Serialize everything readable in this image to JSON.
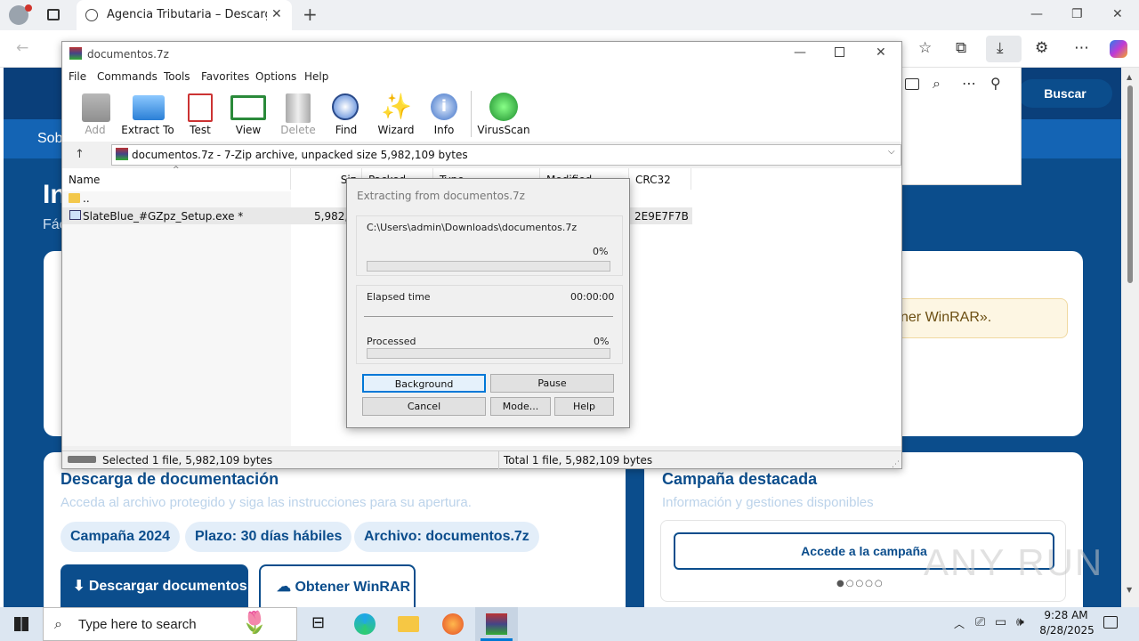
{
  "browser": {
    "tab_title": "Agencia Tributaria – Descarga de",
    "side_buttons": [
      "folder",
      "search",
      "more",
      "pin"
    ]
  },
  "web": {
    "search_button": "Buscar",
    "nav_fragment": "Sob",
    "heading_fragment": "In",
    "sub_fragment": "Fác",
    "notice_fragment": "ner WinRAR».",
    "doc_card": {
      "title": "Descarga de documentación",
      "subtitle": "Acceda al archivo protegido y siga las instrucciones para su apertura.",
      "pills": [
        "Campaña 2024",
        "Plazo: 30 días hábiles",
        "Archivo: documentos.7z"
      ],
      "download_button": "⬇ Descargar documentos",
      "winrar_button": "Obtener WinRAR"
    },
    "campaign_card": {
      "title": "Campaña destacada",
      "subtitle": "Información y gestiones disponibles",
      "button": "Accede a la campaña",
      "dots": "●○○○○"
    },
    "watermark": "ANY RUN"
  },
  "winrar": {
    "title": "documentos.7z",
    "menu": [
      "File",
      "Commands",
      "Tools",
      "Favorites",
      "Options",
      "Help"
    ],
    "toolbar": [
      "Add",
      "Extract To",
      "Test",
      "View",
      "Delete",
      "Find",
      "Wizard",
      "Info",
      "VirusScan"
    ],
    "address": "documentos.7z - 7-Zip archive, unpacked size 5,982,109 bytes",
    "columns": [
      "Name",
      "Siz",
      "Packed",
      "Type",
      "Modified",
      "CRC32"
    ],
    "rows": [
      {
        "name": "..",
        "size": "",
        "crc": ""
      },
      {
        "name": "SlateBlue_#GZpz_Setup.exe *",
        "size": "5,982,1",
        "crc": "2E9E7F7B"
      }
    ],
    "status_left": "Selected 1 file, 5,982,109 bytes",
    "status_right": "Total 1 file, 5,982,109 bytes"
  },
  "dialog": {
    "title": "Extracting from documentos.7z",
    "path": "C:\\Users\\admin\\Downloads\\documentos.7z",
    "file_percent": "0%",
    "file_progress": 0,
    "elapsed_label": "Elapsed time",
    "elapsed_value": "00:00:00",
    "processed_label": "Processed",
    "processed_percent": "0%",
    "processed_progress": 0,
    "buttons": [
      "Background",
      "Pause",
      "Cancel",
      "Mode...",
      "Help"
    ]
  },
  "taskbar": {
    "search_placeholder": "Type here to search",
    "time": "9:28 AM",
    "date": "8/28/2025"
  }
}
